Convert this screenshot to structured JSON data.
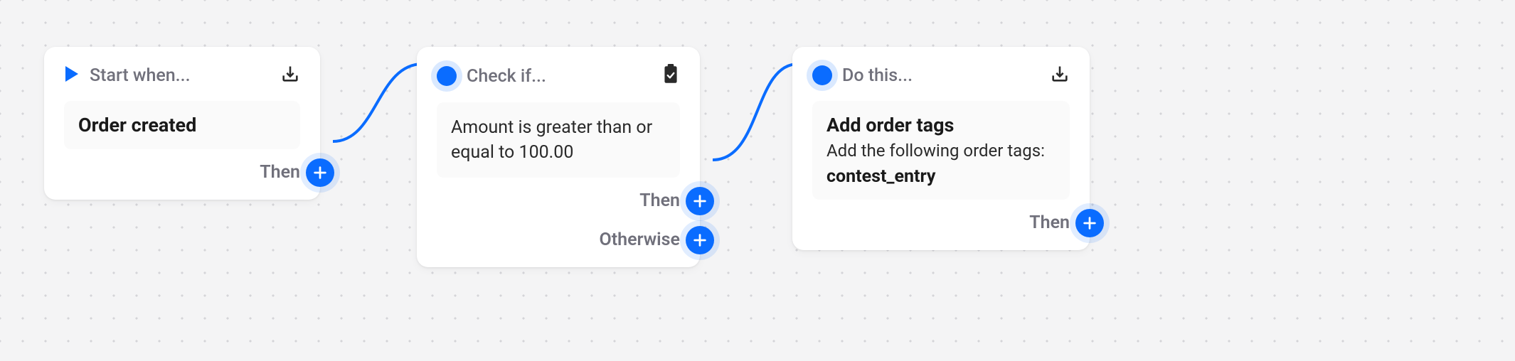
{
  "card1": {
    "header": "Start when...",
    "title": "Order created",
    "port": "Then"
  },
  "card2": {
    "header": "Check if...",
    "body": "Amount is greater than or equal to 100.00",
    "portThen": "Then",
    "portOtherwise": "Otherwise"
  },
  "card3": {
    "header": "Do this...",
    "title": "Add order tags",
    "sub": "Add the following order tags:",
    "tag": "contest_entry",
    "port": "Then"
  },
  "colors": {
    "accent": "#0a6cff",
    "muted": "#70707b"
  }
}
